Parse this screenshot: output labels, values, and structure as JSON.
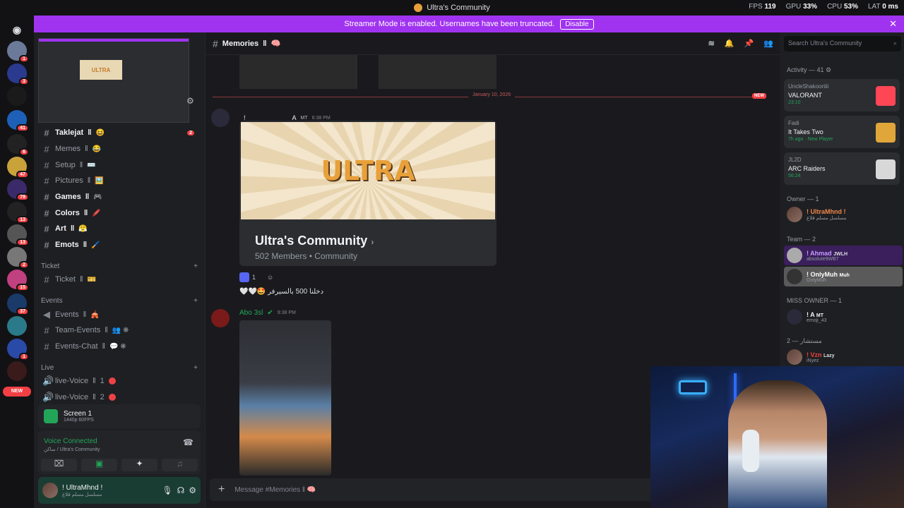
{
  "titlebar": {
    "title": "Ultra's Community",
    "fps_label": "FPS",
    "fps": "119",
    "gpu_label": "GPU",
    "gpu": "33%",
    "cpu_label": "CPU",
    "cpu": "53%",
    "lat_label": "LAT",
    "lat": "0 ms"
  },
  "banner": {
    "text": "Streamer Mode is enabled. Usernames have been truncated.",
    "disable": "Disable"
  },
  "rail": {
    "badges": [
      "1",
      "3",
      "41",
      "6",
      "47",
      "79",
      "13",
      "13",
      "2",
      "15",
      "37",
      "1"
    ],
    "new_label": "NEW"
  },
  "sidebar": {
    "channels": [
      {
        "name": "Taklejat",
        "sep": "‖",
        "emoji": "😆",
        "bold": true,
        "badge": "2"
      },
      {
        "name": "Memes",
        "sep": "‖",
        "emoji": "😂",
        "bold": false
      },
      {
        "name": "Setup",
        "sep": "‖",
        "emoji": "⌨️",
        "bold": false
      },
      {
        "name": "Pictures",
        "sep": "‖",
        "emoji": "🖼️",
        "bold": false
      },
      {
        "name": "Games",
        "sep": "‖",
        "emoji": "🎮",
        "bold": true
      },
      {
        "name": "Colors",
        "sep": "‖",
        "emoji": "🖍️",
        "bold": true
      },
      {
        "name": "Art",
        "sep": "‖",
        "emoji": "😤",
        "bold": true
      },
      {
        "name": "Emots",
        "sep": "‖",
        "emoji": "🖌️",
        "bold": true
      }
    ],
    "cat_ticket": "Ticket",
    "ticket_channel": {
      "name": "Ticket",
      "sep": "‖",
      "emoji": "🎫"
    },
    "cat_events": "Events",
    "events_channels": [
      {
        "name": "Events",
        "sep": "‖",
        "emoji": "🎪"
      },
      {
        "name": "Team-Events",
        "sep": "‖",
        "emoji": "👥 ❋"
      },
      {
        "name": "Events-Chat",
        "sep": "‖",
        "emoji": "💬 ❋"
      }
    ],
    "cat_live": "Live",
    "live_channels": [
      {
        "name": "live-Voice",
        "sep": "‖",
        "num": "1"
      },
      {
        "name": "live-Voice",
        "sep": "‖",
        "num": "2"
      }
    ],
    "screen": {
      "title": "Screen 1",
      "sub": "1440p 60FPS"
    },
    "voice": {
      "status": "Voice Connected",
      "location": "ساكن / Ultra's Community"
    },
    "user": {
      "name": "! UltraMhnd !",
      "status": "مسلسل مسلم قلاع"
    }
  },
  "main": {
    "channel_name": "Memories",
    "channel_sep": "‖",
    "channel_emoji": "🧠",
    "divider_date": "January 10, 2026",
    "new_tag": "NEW",
    "msg1_author": "!",
    "msg1_author2": "A",
    "msg1_tag": "MT",
    "msg1_time": "6:38 PM",
    "card": {
      "logo": "ULTRA",
      "name": "Ultra's Community",
      "members": "502 Members",
      "dot": "•",
      "type": "Community"
    },
    "reaction_count": "1",
    "message_text": "🤍🤍🤩 دخلنا 500 بالسيرفر",
    "msg2_author": "Abo 3sl",
    "msg2_time": "9:38 PM",
    "composer_placeholder": "Message #Memories ‖ 🧠"
  },
  "right": {
    "search_placeholder": "Search Ultra's Community",
    "activity_title": "Activity — 41",
    "activities": [
      {
        "user": "UncleShakooriiii",
        "game": "VALORANT",
        "time": "23:10",
        "thumb_color": "#ff4655"
      },
      {
        "user": "Fadi",
        "game": "It Takes Two",
        "time": "7h ago · New Player",
        "thumb_color": "#e0a63a"
      },
      {
        "user": "JL2D",
        "game": "ARC Raiders",
        "time": "56:24",
        "thumb_color": "#d8d8d8"
      }
    ],
    "owner_title": "Owner — 1",
    "owner": {
      "name": "! UltraMhnd !",
      "status": "مسلسل مسلم قلاع"
    },
    "team_title": "Team — 2",
    "team": [
      {
        "name": "! Ahmad",
        "tag": "JWLH",
        "status": "absolute9WB7"
      },
      {
        "name": "! OnlyMuh",
        "tag": "Muh",
        "status": "OnlyMuh"
      }
    ],
    "miss_owner_title": "MISS OWNER — 1",
    "miss_owner": {
      "name": "! A",
      "tag": "MT",
      "status": "emoji_43"
    },
    "mostashar_title": "مستشار — 2",
    "mostashar": {
      "name": "! Vzn",
      "tag": "Lazy",
      "status": "iNyez"
    }
  },
  "colors": {
    "accent": "#a033f0",
    "online": "#23a559",
    "danger": "#f23f43",
    "owner": "#f0894a"
  },
  "icons": [
    "discord-icon",
    "settings-icon",
    "hash-icon",
    "speaker-icon",
    "bell-icon",
    "pin-icon",
    "members-icon",
    "search-icon",
    "plus-icon",
    "mic-icon",
    "headphones-icon",
    "close-icon"
  ]
}
